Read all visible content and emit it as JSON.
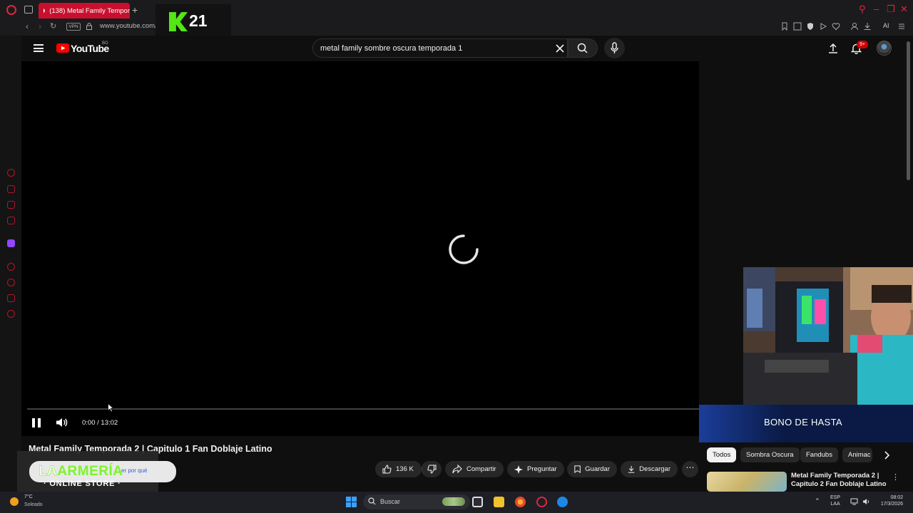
{
  "browser": {
    "tab_title": "(138) Metal Family Tempor",
    "url": "www.youtube.com/wat",
    "vpn_label": "VPN",
    "ai_label": "AI",
    "new_tab_symbol": "+"
  },
  "stream_overlay": {
    "k21_number": "21",
    "bono_text": "BONO DE HASTA"
  },
  "youtube": {
    "logo_text": "YouTube",
    "country_code": "BO",
    "search_query": "metal family sombre oscura temporada 1",
    "notification_badge": "9+"
  },
  "player": {
    "time_display": "0:00 / 13:02",
    "progress": 0.0
  },
  "video": {
    "title": "Metal Family Temporada 2 | Capitulo 1 Fan Doblaje Latino",
    "actions": {
      "likes": "136 K",
      "share": "Compartir",
      "ask": "Preguntar",
      "save": "Guardar",
      "download": "Descargar",
      "more": "⋯"
    }
  },
  "sponsor": {
    "brand_part1": "LA",
    "brand_part2": "ARMERÍA",
    "subtitle": "· ONLINE STORE ·",
    "hidden_link": "er por qué"
  },
  "chips": [
    "Todos",
    "Sombra Oscura",
    "Fandubs",
    "Animac"
  ],
  "recommendation": {
    "title": "Metal Family Temporada 2 | Capitulo 2 Fan Doblaje Latino"
  },
  "taskbar": {
    "weather_temp": "7°C",
    "weather_cond": "Soleado",
    "search_placeholder": "Buscar",
    "lang_line1": "ESP",
    "lang_line2": "LAA",
    "time": "08:02",
    "date": "17/3/2026"
  },
  "colors": {
    "opera_red": "#e0263d",
    "yt_red": "#ff0000",
    "yt_bg": "#0f0f0f",
    "k21_green": "#54e616"
  }
}
